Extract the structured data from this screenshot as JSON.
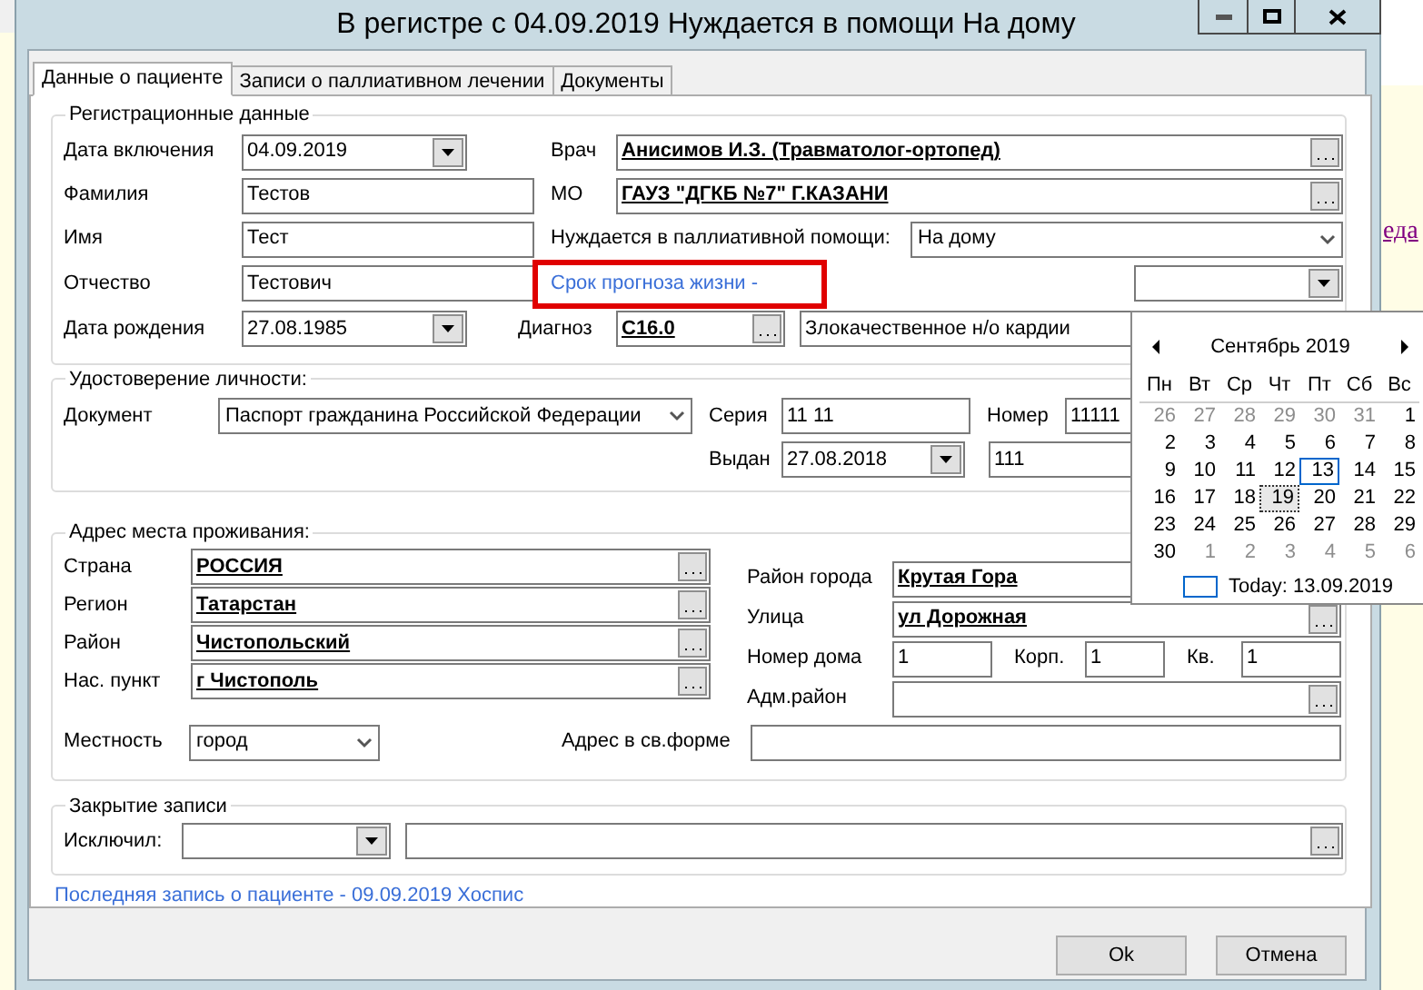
{
  "background": {
    "link": "еда"
  },
  "window": {
    "title": "В регистре с 04.09.2019 Нуждается в помощи На дому"
  },
  "tabs": [
    {
      "label": "Данные о пациенте",
      "selected": true
    },
    {
      "label": "Записи о паллиативном лечении",
      "selected": false
    },
    {
      "label": "Документы",
      "selected": false
    }
  ],
  "registration": {
    "title": "Регистрационные данные",
    "fields": [
      {
        "label": "Дата включения",
        "value": "04.09.2019",
        "kind": "date"
      },
      {
        "label": "Фамилия",
        "value": "Тестов",
        "kind": "text"
      },
      {
        "label": "Имя",
        "value": "Тест",
        "kind": "text"
      },
      {
        "label": "Отчество",
        "value": "Тестович",
        "kind": "text"
      },
      {
        "label": "Дата рождения",
        "value": "27.08.1985",
        "kind": "date"
      }
    ],
    "doctor": {
      "label": "Врач",
      "value": "Анисимов И.З. (Травматолог-ортопед)"
    },
    "mo": {
      "label": "МО",
      "value": "ГАУЗ \"ДГКБ №7\" Г.КАЗАНИ"
    },
    "needs": {
      "label": "Нуждается в паллиативной помощи:",
      "value": "На дому"
    },
    "prognosis_link": "Срок прогноза жизни -",
    "diagnosis": {
      "label": "Диагноз",
      "code": "C16.0",
      "name": "Злокачественное н/о кардии"
    }
  },
  "identity": {
    "title": "Удостоверение личности:",
    "document_label": "Документ",
    "document": "Паспорт гражданина Российской Федерации",
    "series_label": "Серия",
    "series": "11 11",
    "number_label": "Номер",
    "number": "11111",
    "issued_label": "Выдан",
    "issued": "27.08.2018",
    "issued_by": "111"
  },
  "address": {
    "title": "Адрес места проживания:",
    "left": [
      {
        "label": "Страна",
        "value": "РОССИЯ"
      },
      {
        "label": "Регион",
        "value": "Татарстан"
      },
      {
        "label": "Район",
        "value": "Чистопольский"
      },
      {
        "label": "Нас. пункт",
        "value": "г Чистополь"
      }
    ],
    "district_label": "Район города",
    "district": "Крутая Гора",
    "street_label": "Улица",
    "street": "ул Дорожная",
    "house_label": "Номер дома",
    "house": "1",
    "building_label": "Корп.",
    "building": "1",
    "flat_label": "Кв.",
    "flat": "1",
    "adm_label": "Адм.район",
    "locality_label": "Местность",
    "locality": "город",
    "free_label": "Адрес в св.форме"
  },
  "closing": {
    "title": "Закрытие записи",
    "excluded_label": "Исключил:"
  },
  "last_record_link": "Последняя запись о пациенте - 09.09.2019 Хоспис",
  "buttons": [
    "Ok",
    "Отмена"
  ],
  "calendar": {
    "month": "Сентябрь 2019",
    "weekdays": [
      "Пн",
      "Вт",
      "Ср",
      "Чт",
      "Пт",
      "Сб",
      "Вс"
    ],
    "weeks": [
      [
        {
          "day": "26",
          "other": true,
          "today": false,
          "selected": false
        },
        {
          "day": "27",
          "other": true,
          "today": false,
          "selected": false
        },
        {
          "day": "28",
          "other": true,
          "today": false,
          "selected": false
        },
        {
          "day": "29",
          "other": true,
          "today": false,
          "selected": false
        },
        {
          "day": "30",
          "other": true,
          "today": false,
          "selected": false
        },
        {
          "day": "31",
          "other": true,
          "today": false,
          "selected": false
        },
        {
          "day": "1",
          "other": false,
          "today": false,
          "selected": false
        }
      ],
      [
        {
          "day": "2",
          "other": false,
          "today": false,
          "selected": false
        },
        {
          "day": "3",
          "other": false,
          "today": false,
          "selected": false
        },
        {
          "day": "4",
          "other": false,
          "today": false,
          "selected": false
        },
        {
          "day": "5",
          "other": false,
          "today": false,
          "selected": false
        },
        {
          "day": "6",
          "other": false,
          "today": false,
          "selected": false
        },
        {
          "day": "7",
          "other": false,
          "today": false,
          "selected": false
        },
        {
          "day": "8",
          "other": false,
          "today": false,
          "selected": false
        }
      ],
      [
        {
          "day": "9",
          "other": false,
          "today": false,
          "selected": false
        },
        {
          "day": "10",
          "other": false,
          "today": false,
          "selected": false
        },
        {
          "day": "11",
          "other": false,
          "today": false,
          "selected": false
        },
        {
          "day": "12",
          "other": false,
          "today": false,
          "selected": false
        },
        {
          "day": "13",
          "other": false,
          "today": true,
          "selected": false
        },
        {
          "day": "14",
          "other": false,
          "today": false,
          "selected": false
        },
        {
          "day": "15",
          "other": false,
          "today": false,
          "selected": false
        }
      ],
      [
        {
          "day": "16",
          "other": false,
          "today": false,
          "selected": false
        },
        {
          "day": "17",
          "other": false,
          "today": false,
          "selected": false
        },
        {
          "day": "18",
          "other": false,
          "today": false,
          "selected": false
        },
        {
          "day": "19",
          "other": false,
          "today": false,
          "selected": true
        },
        {
          "day": "20",
          "other": false,
          "today": false,
          "selected": false
        },
        {
          "day": "21",
          "other": false,
          "today": false,
          "selected": false
        },
        {
          "day": "22",
          "other": false,
          "today": false,
          "selected": false
        }
      ],
      [
        {
          "day": "23",
          "other": false,
          "today": false,
          "selected": false
        },
        {
          "day": "24",
          "other": false,
          "today": false,
          "selected": false
        },
        {
          "day": "25",
          "other": false,
          "today": false,
          "selected": false
        },
        {
          "day": "26",
          "other": false,
          "today": false,
          "selected": false
        },
        {
          "day": "27",
          "other": false,
          "today": false,
          "selected": false
        },
        {
          "day": "28",
          "other": false,
          "today": false,
          "selected": false
        },
        {
          "day": "29",
          "other": false,
          "today": false,
          "selected": false
        }
      ],
      [
        {
          "day": "30",
          "other": false,
          "today": false,
          "selected": false
        },
        {
          "day": "1",
          "other": true,
          "today": false,
          "selected": false
        },
        {
          "day": "2",
          "other": true,
          "today": false,
          "selected": false
        },
        {
          "day": "3",
          "other": true,
          "today": false,
          "selected": false
        },
        {
          "day": "4",
          "other": true,
          "today": false,
          "selected": false
        },
        {
          "day": "5",
          "other": true,
          "today": false,
          "selected": false
        },
        {
          "day": "6",
          "other": true,
          "today": false,
          "selected": false
        }
      ]
    ],
    "today_text": "Today: 13.09.2019"
  }
}
